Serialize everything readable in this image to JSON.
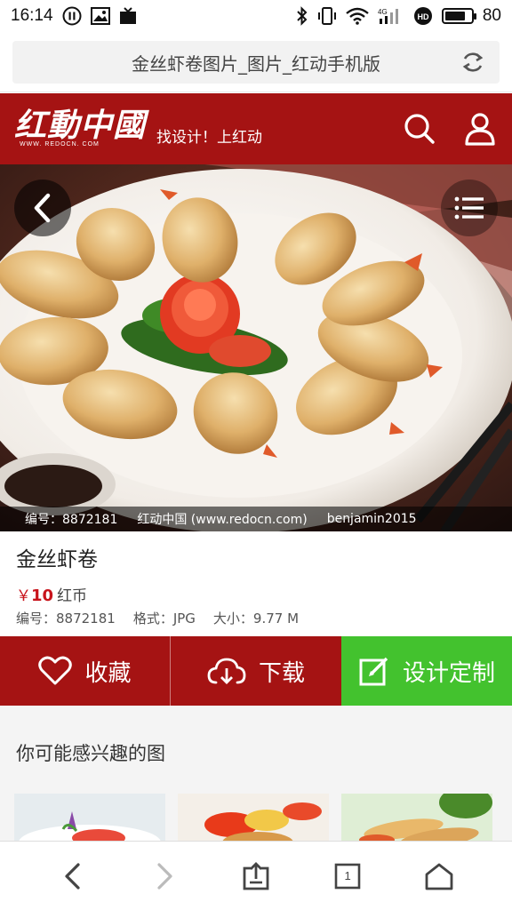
{
  "status_bar": {
    "time": "16:14",
    "battery_level": "80",
    "icons": [
      "pause-icon",
      "image-icon",
      "tv-icon",
      "bluetooth-icon",
      "vibrate-icon",
      "wifi-icon",
      "signal-4g-icon",
      "hd-icon",
      "battery-icon"
    ]
  },
  "browser": {
    "page_title": "金丝虾卷图片_图片_红动手机版"
  },
  "header": {
    "logo_text": "红動中國",
    "logo_url_text": "WWW. REDOCN. COM",
    "slogan": "找设计！上红动"
  },
  "hero": {
    "watermark": {
      "id_text": "编号：8872181",
      "site_text": "红动中国 (www.redocn.com)",
      "author_text": "benjamin2015"
    }
  },
  "product": {
    "title": "金丝虾卷",
    "currency_symbol": "￥",
    "price": "10",
    "price_unit": "红币",
    "id_label": "编号：8872181",
    "format_label": "格式：JPG",
    "size_label": "大小：9.77 M"
  },
  "actions": {
    "favorite_label": "收藏",
    "download_label": "下载",
    "custom_label": "设计定制"
  },
  "recommendations": {
    "title": "你可能感兴趣的图"
  },
  "bottom_nav": {
    "tab_count": "1"
  },
  "colors": {
    "brand_red": "#a51313",
    "accent_green": "#43c22e",
    "price_red": "#c8141c"
  }
}
